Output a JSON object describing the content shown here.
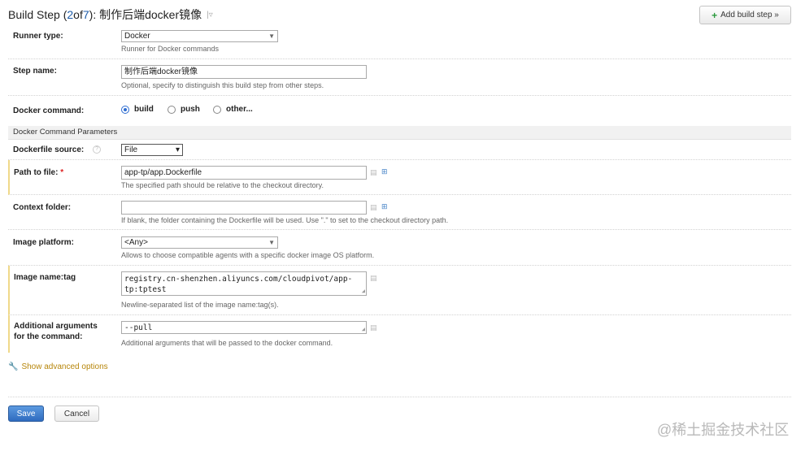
{
  "header": {
    "prefix": "Build Step (",
    "step_current": "2",
    "of_text": " of ",
    "step_total": "7",
    "suffix": "): 制作后端docker镜像",
    "caret": "|▿",
    "add_button_label": "Add build step »"
  },
  "runner": {
    "label": "Runner type:",
    "value": "Docker",
    "hint": "Runner for Docker commands"
  },
  "step_name": {
    "label": "Step name:",
    "value": "制作后端docker镜像",
    "hint": "Optional, specify to distinguish this build step from other steps."
  },
  "docker_command": {
    "label": "Docker command:",
    "options": [
      {
        "label": "build",
        "selected": true
      },
      {
        "label": "push",
        "selected": false
      },
      {
        "label": "other...",
        "selected": false
      }
    ]
  },
  "section_title": "Docker Command Parameters",
  "dockerfile_source": {
    "label": "Dockerfile source:",
    "help": "?",
    "value": "File"
  },
  "path_to_file": {
    "label": "Path to file:",
    "required_mark": "*",
    "value": "app-tp/app.Dockerfile",
    "hint": "The specified path should be relative to the checkout directory."
  },
  "context_folder": {
    "label": "Context folder:",
    "value": "",
    "hint": "If blank, the folder containing the Dockerfile will be used. Use \".\" to set to the checkout directory path."
  },
  "image_platform": {
    "label": "Image platform:",
    "value": "<Any>",
    "hint": "Allows to choose compatible agents with a specific docker image OS platform."
  },
  "image_name_tag": {
    "label": "Image name:tag",
    "line1": "registry.cn-shenzhen.aliyuncs.com/cloudpivot/app-",
    "line2": "tp:tptest",
    "hint": "Newline-separated list of the image name:tag(s)."
  },
  "additional_args": {
    "label_line1": "Additional arguments",
    "label_line2": "for the command:",
    "value": "--pull",
    "hint": "Additional arguments that will be passed to the docker command."
  },
  "advanced_link": "Show advanced options",
  "buttons": {
    "save": "Save",
    "cancel": "Cancel"
  },
  "watermark": "@稀土掘金技术社区",
  "colors": {
    "link": "#1d5ba8",
    "advanced": "#b7860b",
    "required_border": "#f0d98a",
    "save_bg": "#2f6bbf",
    "add_plus": "#2b9a3e"
  },
  "icons": {
    "add": "plus-icon",
    "note": "note-icon",
    "tree": "tree-picker-icon",
    "wrench": "wrench-icon",
    "help": "help-icon"
  }
}
